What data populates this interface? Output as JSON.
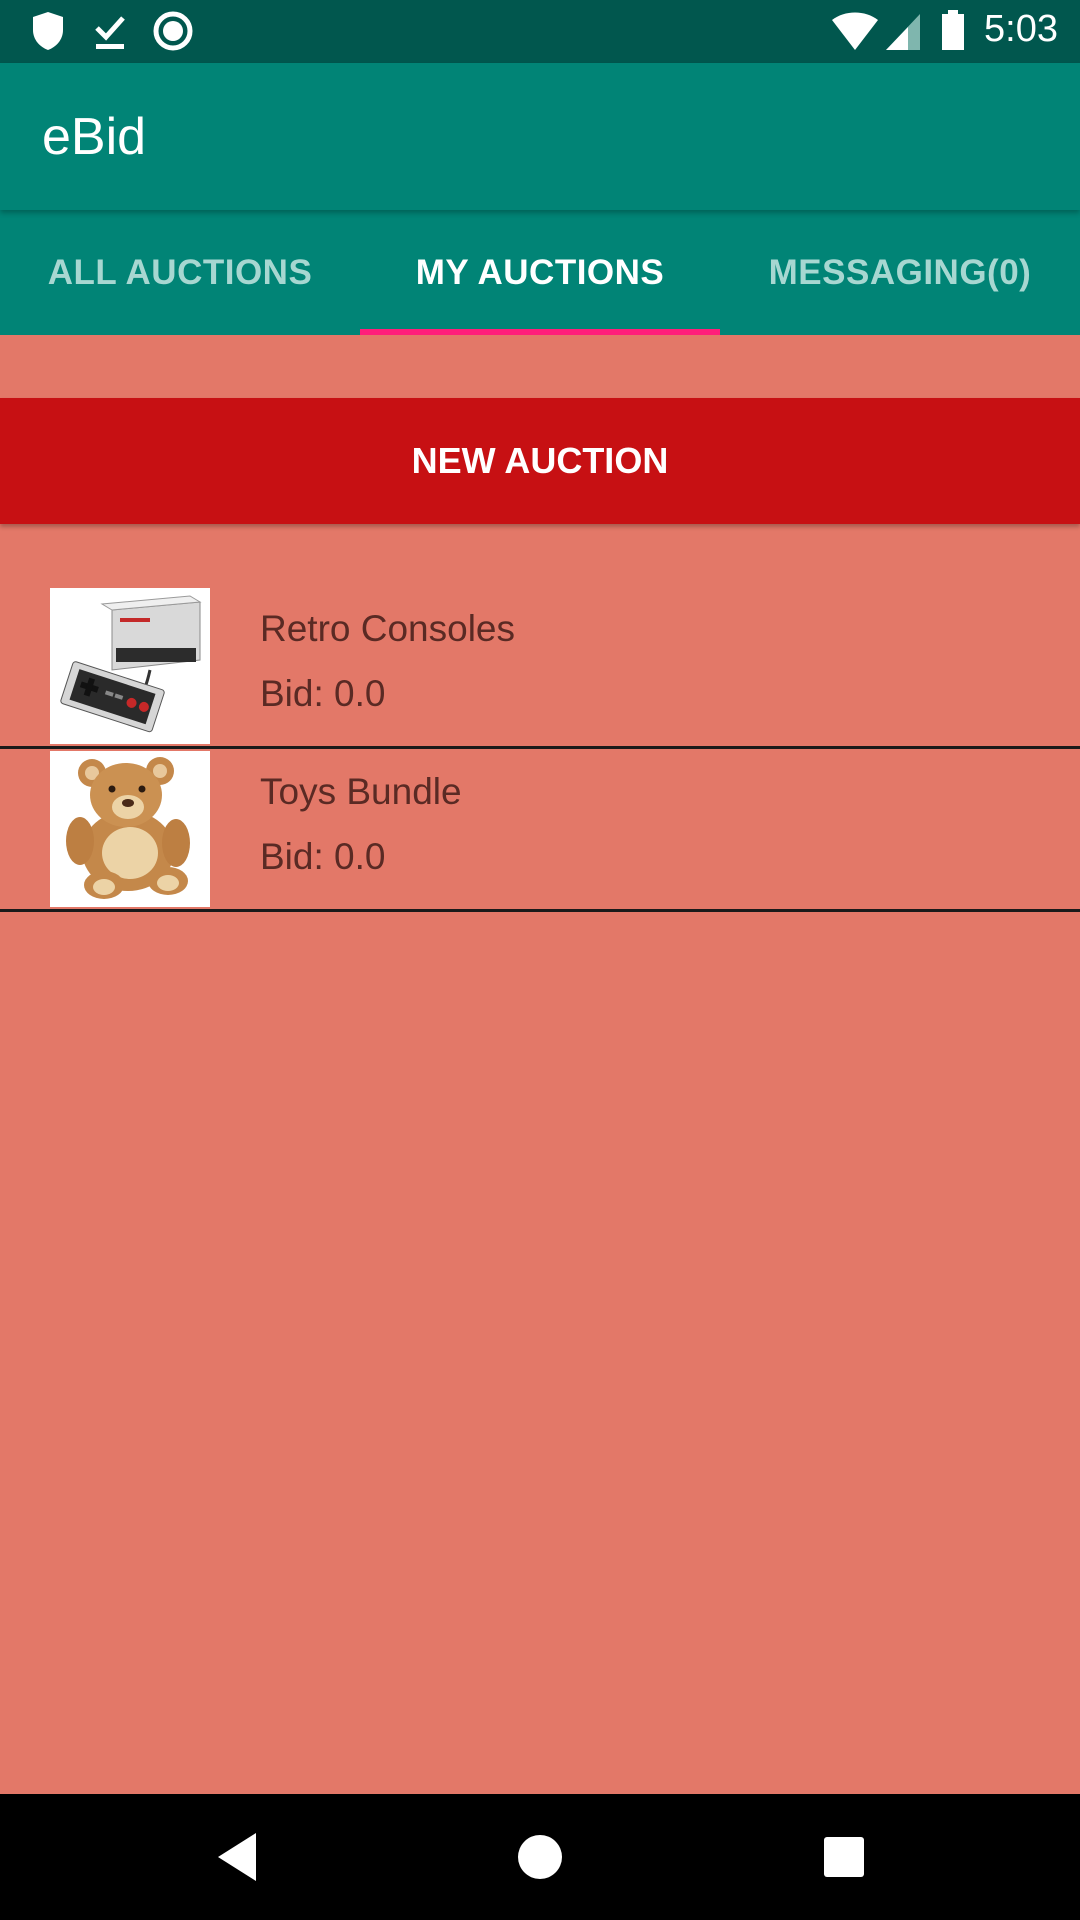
{
  "status_bar": {
    "time": "5:03",
    "left_icons": [
      "shield-icon",
      "download-done-icon",
      "record-icon"
    ],
    "right_icons": [
      "wifi-icon",
      "signal-icon",
      "battery-icon"
    ]
  },
  "app_bar": {
    "title": "eBid"
  },
  "tabs": [
    {
      "label": "ALL AUCTIONS",
      "active": false
    },
    {
      "label": "MY AUCTIONS",
      "active": true
    },
    {
      "label": "MESSAGING(0)",
      "active": false
    }
  ],
  "new_auction_label": "NEW AUCTION",
  "auctions": [
    {
      "title": "Retro Consoles",
      "bid": "Bid: 0.0",
      "image_icon": "retro-console-image"
    },
    {
      "title": "Toys Bundle",
      "bid": "Bid: 0.0",
      "image_icon": "teddy-bear-image"
    }
  ],
  "nav_bar": {
    "icons": [
      "back-icon",
      "home-icon",
      "recents-icon"
    ]
  },
  "colors": {
    "status_bar": "#01574e",
    "app_bar": "#018476",
    "tab_indicator": "#ff1f7a",
    "new_auction_button": "#c71013",
    "background": "#e37868"
  }
}
